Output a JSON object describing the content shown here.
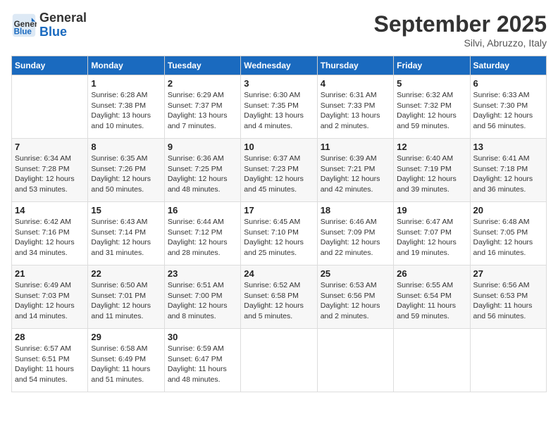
{
  "header": {
    "logo_line1": "General",
    "logo_line2": "Blue",
    "month": "September 2025",
    "location": "Silvi, Abruzzo, Italy"
  },
  "weekdays": [
    "Sunday",
    "Monday",
    "Tuesday",
    "Wednesday",
    "Thursday",
    "Friday",
    "Saturday"
  ],
  "weeks": [
    [
      {
        "day": "",
        "info": ""
      },
      {
        "day": "1",
        "info": "Sunrise: 6:28 AM\nSunset: 7:38 PM\nDaylight: 13 hours\nand 10 minutes."
      },
      {
        "day": "2",
        "info": "Sunrise: 6:29 AM\nSunset: 7:37 PM\nDaylight: 13 hours\nand 7 minutes."
      },
      {
        "day": "3",
        "info": "Sunrise: 6:30 AM\nSunset: 7:35 PM\nDaylight: 13 hours\nand 4 minutes."
      },
      {
        "day": "4",
        "info": "Sunrise: 6:31 AM\nSunset: 7:33 PM\nDaylight: 13 hours\nand 2 minutes."
      },
      {
        "day": "5",
        "info": "Sunrise: 6:32 AM\nSunset: 7:32 PM\nDaylight: 12 hours\nand 59 minutes."
      },
      {
        "day": "6",
        "info": "Sunrise: 6:33 AM\nSunset: 7:30 PM\nDaylight: 12 hours\nand 56 minutes."
      }
    ],
    [
      {
        "day": "7",
        "info": "Sunrise: 6:34 AM\nSunset: 7:28 PM\nDaylight: 12 hours\nand 53 minutes."
      },
      {
        "day": "8",
        "info": "Sunrise: 6:35 AM\nSunset: 7:26 PM\nDaylight: 12 hours\nand 50 minutes."
      },
      {
        "day": "9",
        "info": "Sunrise: 6:36 AM\nSunset: 7:25 PM\nDaylight: 12 hours\nand 48 minutes."
      },
      {
        "day": "10",
        "info": "Sunrise: 6:37 AM\nSunset: 7:23 PM\nDaylight: 12 hours\nand 45 minutes."
      },
      {
        "day": "11",
        "info": "Sunrise: 6:39 AM\nSunset: 7:21 PM\nDaylight: 12 hours\nand 42 minutes."
      },
      {
        "day": "12",
        "info": "Sunrise: 6:40 AM\nSunset: 7:19 PM\nDaylight: 12 hours\nand 39 minutes."
      },
      {
        "day": "13",
        "info": "Sunrise: 6:41 AM\nSunset: 7:18 PM\nDaylight: 12 hours\nand 36 minutes."
      }
    ],
    [
      {
        "day": "14",
        "info": "Sunrise: 6:42 AM\nSunset: 7:16 PM\nDaylight: 12 hours\nand 34 minutes."
      },
      {
        "day": "15",
        "info": "Sunrise: 6:43 AM\nSunset: 7:14 PM\nDaylight: 12 hours\nand 31 minutes."
      },
      {
        "day": "16",
        "info": "Sunrise: 6:44 AM\nSunset: 7:12 PM\nDaylight: 12 hours\nand 28 minutes."
      },
      {
        "day": "17",
        "info": "Sunrise: 6:45 AM\nSunset: 7:10 PM\nDaylight: 12 hours\nand 25 minutes."
      },
      {
        "day": "18",
        "info": "Sunrise: 6:46 AM\nSunset: 7:09 PM\nDaylight: 12 hours\nand 22 minutes."
      },
      {
        "day": "19",
        "info": "Sunrise: 6:47 AM\nSunset: 7:07 PM\nDaylight: 12 hours\nand 19 minutes."
      },
      {
        "day": "20",
        "info": "Sunrise: 6:48 AM\nSunset: 7:05 PM\nDaylight: 12 hours\nand 16 minutes."
      }
    ],
    [
      {
        "day": "21",
        "info": "Sunrise: 6:49 AM\nSunset: 7:03 PM\nDaylight: 12 hours\nand 14 minutes."
      },
      {
        "day": "22",
        "info": "Sunrise: 6:50 AM\nSunset: 7:01 PM\nDaylight: 12 hours\nand 11 minutes."
      },
      {
        "day": "23",
        "info": "Sunrise: 6:51 AM\nSunset: 7:00 PM\nDaylight: 12 hours\nand 8 minutes."
      },
      {
        "day": "24",
        "info": "Sunrise: 6:52 AM\nSunset: 6:58 PM\nDaylight: 12 hours\nand 5 minutes."
      },
      {
        "day": "25",
        "info": "Sunrise: 6:53 AM\nSunset: 6:56 PM\nDaylight: 12 hours\nand 2 minutes."
      },
      {
        "day": "26",
        "info": "Sunrise: 6:55 AM\nSunset: 6:54 PM\nDaylight: 11 hours\nand 59 minutes."
      },
      {
        "day": "27",
        "info": "Sunrise: 6:56 AM\nSunset: 6:53 PM\nDaylight: 11 hours\nand 56 minutes."
      }
    ],
    [
      {
        "day": "28",
        "info": "Sunrise: 6:57 AM\nSunset: 6:51 PM\nDaylight: 11 hours\nand 54 minutes."
      },
      {
        "day": "29",
        "info": "Sunrise: 6:58 AM\nSunset: 6:49 PM\nDaylight: 11 hours\nand 51 minutes."
      },
      {
        "day": "30",
        "info": "Sunrise: 6:59 AM\nSunset: 6:47 PM\nDaylight: 11 hours\nand 48 minutes."
      },
      {
        "day": "",
        "info": ""
      },
      {
        "day": "",
        "info": ""
      },
      {
        "day": "",
        "info": ""
      },
      {
        "day": "",
        "info": ""
      }
    ]
  ]
}
